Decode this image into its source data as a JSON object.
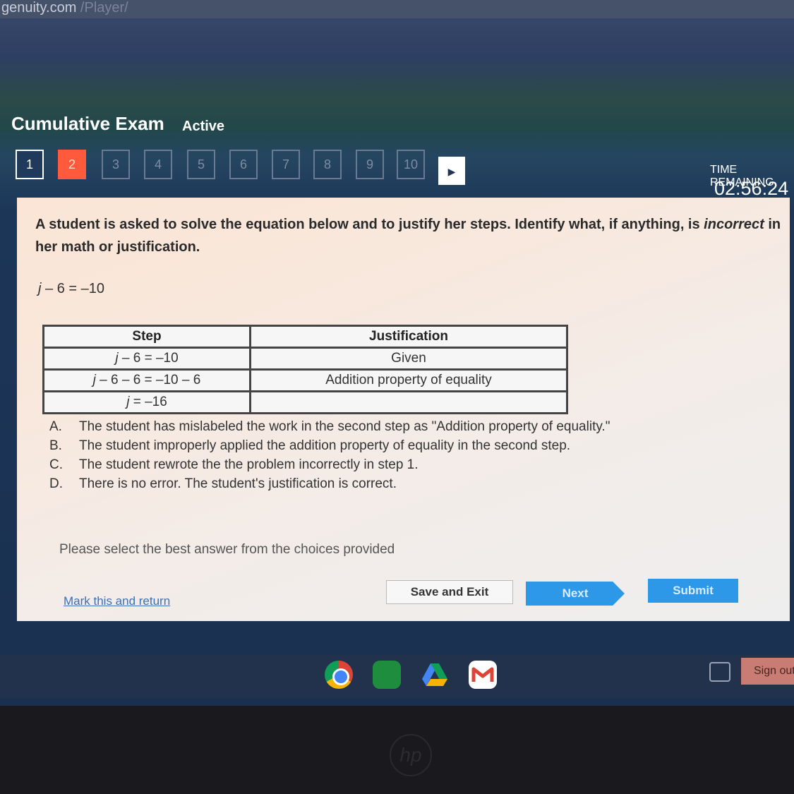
{
  "browser": {
    "url_host": "genuity.com",
    "url_path": "/Player/"
  },
  "exam": {
    "title": "Cumulative Exam",
    "status": "Active"
  },
  "question_nav": {
    "items": [
      "1",
      "2",
      "3",
      "4",
      "5",
      "6",
      "7",
      "8",
      "9",
      "10"
    ],
    "current": "2",
    "arrow": "▶"
  },
  "timer": {
    "label": "TIME REMAINING",
    "value": "02:56:24"
  },
  "question": {
    "text_part1": "A student is asked to solve the equation below and to justify her steps. Identify what, if anything, is ",
    "text_emphasis": "incorrect",
    "text_part2": " in her math or justification.",
    "equation_var": "j",
    "equation_rest": " – 6 = –10"
  },
  "steps_table": {
    "headers": [
      "Step",
      "Justification"
    ],
    "rows": [
      {
        "var": "j",
        "step": " – 6 = –10",
        "justification": "Given"
      },
      {
        "var": "j",
        "step": " – 6 – 6 = –10 – 6",
        "justification": "Addition property of equality"
      },
      {
        "var": "j",
        "step": " = –16",
        "justification": ""
      }
    ]
  },
  "choices": [
    {
      "letter": "A.",
      "text": "The student has mislabeled the work in the second step as \"Addition property of equality.\""
    },
    {
      "letter": "B.",
      "text": "The student improperly applied the addition property of equality in the second step."
    },
    {
      "letter": "C.",
      "text": "The student rewrote the the problem incorrectly in step 1."
    },
    {
      "letter": "D.",
      "text": "There is no error. The student's justification is correct."
    }
  ],
  "hint": "Please select the best answer from the choices provided",
  "footer": {
    "mark_label": "Mark this and return",
    "save_label": "Save and Exit",
    "next_label": "Next",
    "submit_label": "Submit"
  },
  "shelf": {
    "apps": [
      "chrome-icon",
      "classroom-icon",
      "drive-icon",
      "gmail-icon"
    ],
    "signout_label": "Sign out"
  },
  "colors": {
    "current_question": "#ff5a3c",
    "primary_button": "#2d98e8",
    "link": "#3d6fb3"
  }
}
